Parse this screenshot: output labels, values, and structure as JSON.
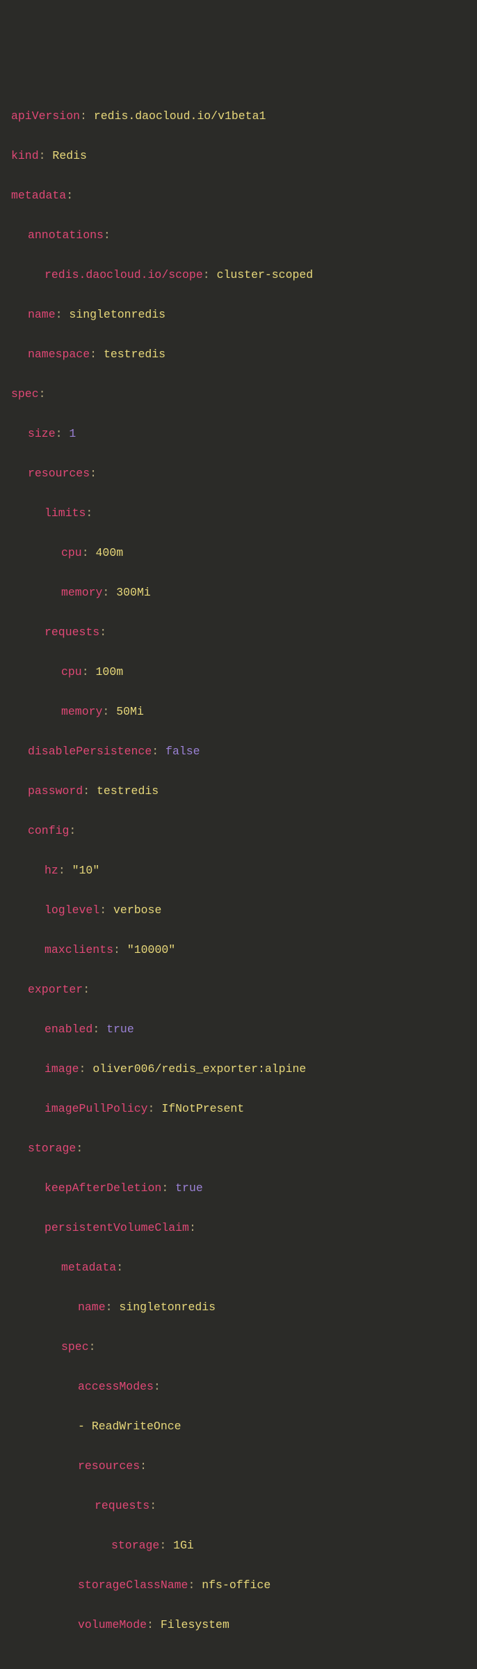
{
  "l1k": "apiVersion",
  "l1v": "redis.daocloud.io/v1beta1",
  "l2k": "kind",
  "l2v": "Redis",
  "l3k": "metadata",
  "l4k": "annotations",
  "l5k": "redis.daocloud.io/scope",
  "l5v": "cluster-scoped",
  "l6k": "name",
  "l6v": "singletonredis",
  "l7k": "namespace",
  "l7v": "testredis",
  "l8k": "spec",
  "l9k": "size",
  "l9v": "1",
  "l10k": "resources",
  "l11k": "limits",
  "l12k": "cpu",
  "l12v": "400m",
  "l13k": "memory",
  "l13v": "300Mi",
  "l14k": "requests",
  "l15k": "cpu",
  "l15v": "100m",
  "l16k": "memory",
  "l16v": "50Mi",
  "l17k": "disablePersistence",
  "l17v": "false",
  "l18k": "password",
  "l18v": "testredis",
  "l19k": "config",
  "l20k": "hz",
  "l20v": "\"10\"",
  "l21k": "loglevel",
  "l21v": "verbose",
  "l22k": "maxclients",
  "l22v": "\"10000\"",
  "l23k": "exporter",
  "l24k": "enabled",
  "l24v": "true",
  "l25k": "image",
  "l25v": "oliver006/redis_exporter:alpine",
  "l26k": "imagePullPolicy",
  "l26v": "IfNotPresent",
  "l27k": "storage",
  "l28k": "keepAfterDeletion",
  "l28v": "true",
  "l29k": "persistentVolumeClaim",
  "l30k": "metadata",
  "l31k": "name",
  "l31v": "singletonredis",
  "l32k": "spec",
  "l33k": "accessModes",
  "l34v": "ReadWriteOnce",
  "l35k": "resources",
  "l36k": "requests",
  "l37k": "storage",
  "l37v": "1Gi",
  "l38k": "storageClassName",
  "l38v": "nfs-office",
  "l39k": "volumeMode",
  "l39v": "Filesystem"
}
